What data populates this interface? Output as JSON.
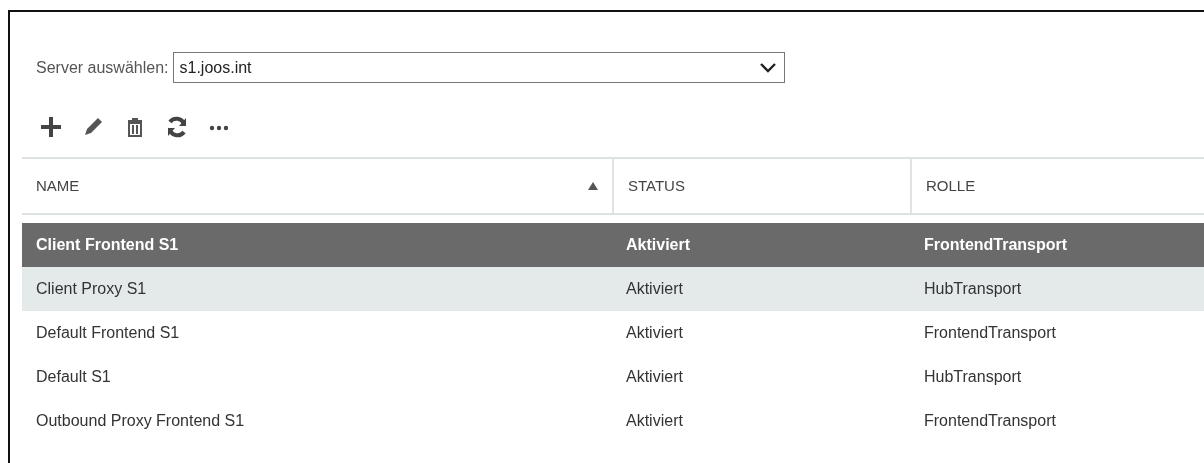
{
  "server_select": {
    "label": "Server auswählen:",
    "value": "s1.joos.int"
  },
  "table": {
    "columns": [
      {
        "label": "NAME",
        "sorted": true
      },
      {
        "label": "STATUS",
        "sorted": false
      },
      {
        "label": "ROLLE",
        "sorted": false
      }
    ],
    "rows": [
      {
        "cells": [
          "Client Frontend S1",
          "Aktiviert",
          "FrontendTransport"
        ],
        "selected": true,
        "hovered": false
      },
      {
        "cells": [
          "Client Proxy S1",
          "Aktiviert",
          "HubTransport"
        ],
        "selected": false,
        "hovered": true
      },
      {
        "cells": [
          "Default Frontend S1",
          "Aktiviert",
          "FrontendTransport"
        ],
        "selected": false,
        "hovered": false
      },
      {
        "cells": [
          "Default S1",
          "Aktiviert",
          "HubTransport"
        ],
        "selected": false,
        "hovered": false
      },
      {
        "cells": [
          "Outbound Proxy Frontend S1",
          "Aktiviert",
          "FrontendTransport"
        ],
        "selected": false,
        "hovered": false
      }
    ]
  }
}
